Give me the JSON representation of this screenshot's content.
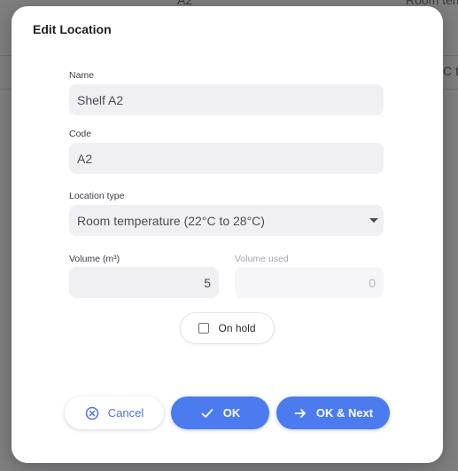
{
  "background": {
    "cell_a2": "A2",
    "cell_room_temp": "Room tem",
    "cell_c_t": "C t"
  },
  "dialog": {
    "title": "Edit Location",
    "name": {
      "label": "Name",
      "value": "Shelf A2"
    },
    "code": {
      "label": "Code",
      "value": "A2"
    },
    "location_type": {
      "label": "Location type",
      "value": "Room temperature (22°C to 28°C)"
    },
    "volume": {
      "label": "Volume (m³)",
      "value": "5"
    },
    "volume_used": {
      "label": "Volume used",
      "value": "0"
    },
    "on_hold": {
      "label": "On hold",
      "checked": false
    },
    "buttons": {
      "cancel": "Cancel",
      "ok": "OK",
      "ok_next": "OK & Next"
    }
  },
  "colors": {
    "accent": "#4b7bef",
    "field_bg": "#f0f0f3",
    "overlay": "#7f7f80"
  },
  "icons": {
    "cancel": "circle-x-icon",
    "ok": "check-icon",
    "ok_next": "arrow-right-icon",
    "select": "caret-down-icon"
  }
}
